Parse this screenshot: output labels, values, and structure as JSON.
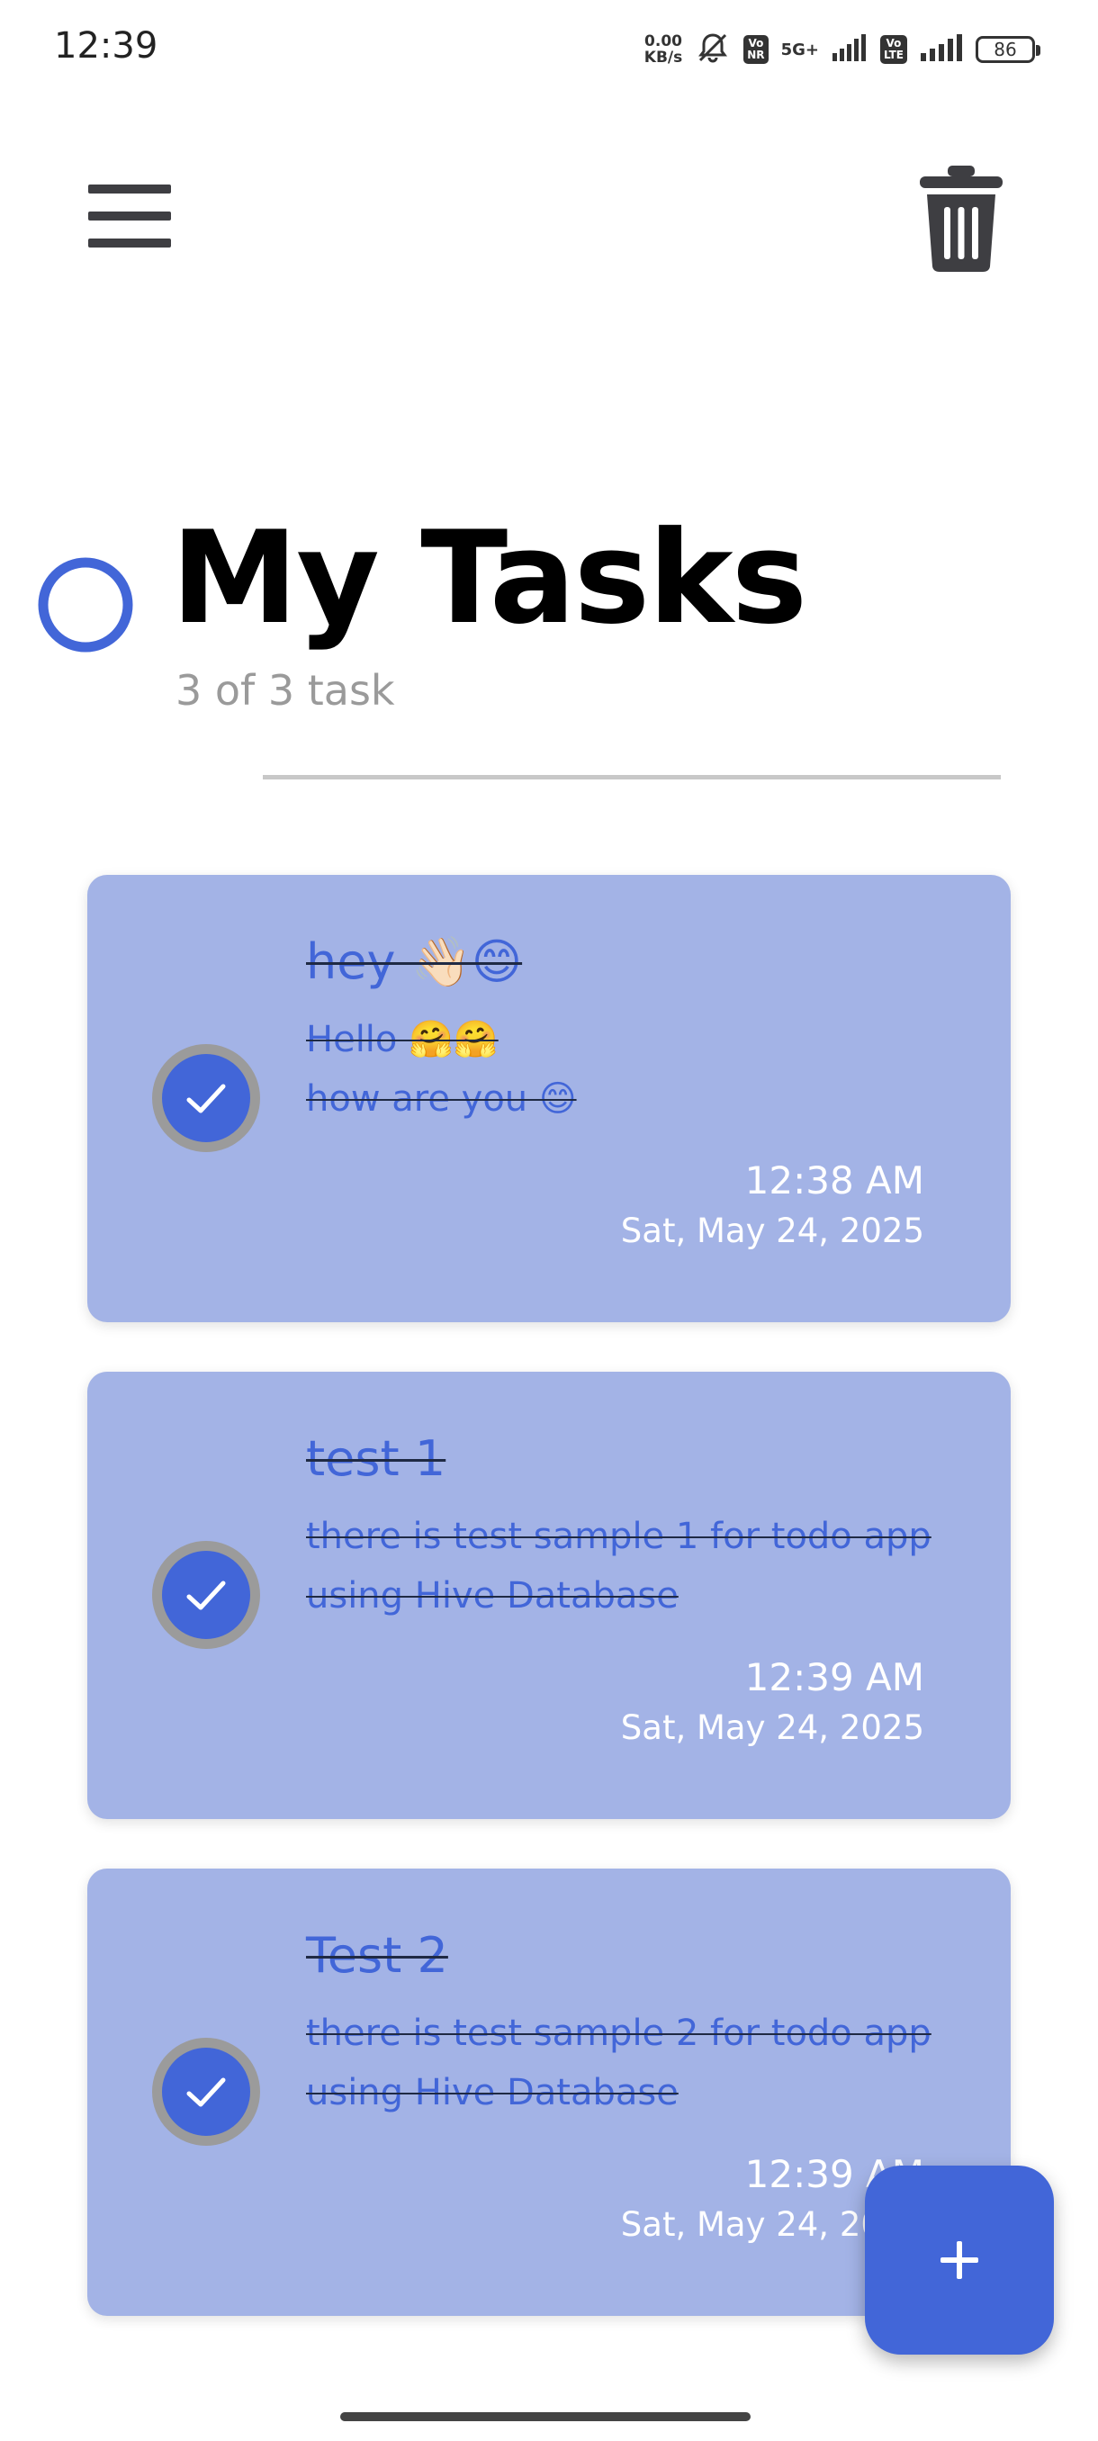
{
  "status_bar": {
    "time": "12:39",
    "net_speed_value": "0.00",
    "net_speed_unit": "KB/s",
    "volte_badge_1": "Vo\nNR",
    "network_type": "5G+",
    "volte_badge_2": "Vo\nLTE",
    "battery_level": "86",
    "icons": [
      "bell-muted-icon",
      "signal-icon",
      "signal-icon",
      "battery-icon"
    ]
  },
  "app_bar": {
    "menu_icon": "hamburger-menu-icon",
    "delete_icon": "trash-icon"
  },
  "header": {
    "title": "My Tasks",
    "task_count": "3 of 3 task",
    "progress_fraction": 1.0,
    "accent_color": "#4266d8"
  },
  "tasks": [
    {
      "title": "hey 👋🏻😊",
      "description": "Hello 🤗🤗\nhow are you 😊",
      "time": "12:38 AM",
      "date": "Sat, May 24, 2025",
      "completed": true
    },
    {
      "title": "test 1",
      "description": "there is test sample 1 for  todo app using Hive Database",
      "time": "12:39 AM",
      "date": "Sat, May 24, 2025",
      "completed": true
    },
    {
      "title": "Test 2",
      "description": "there is test sample 2 for  todo app using Hive Database",
      "time": "12:39 AM",
      "date": "Sat, May 24, 2025",
      "completed": true
    }
  ],
  "fab": {
    "icon": "plus-icon"
  },
  "colors": {
    "card_background": "#a3b3e6",
    "accent": "#4266d8",
    "check_ring": "#9b9b9b"
  }
}
